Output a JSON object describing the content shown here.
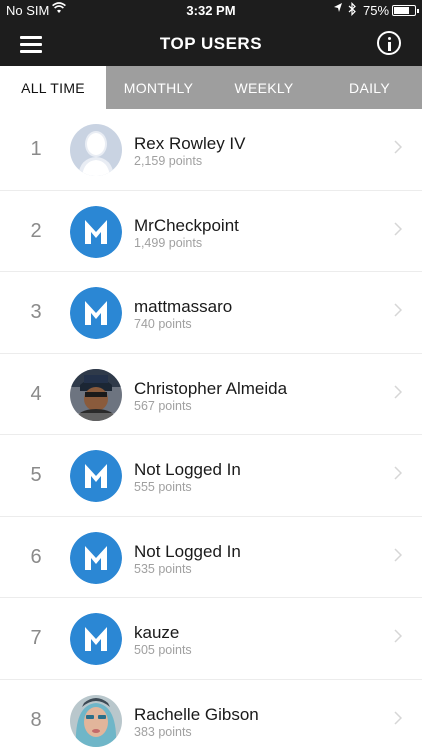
{
  "status_bar": {
    "carrier": "No SIM",
    "time": "3:32 PM",
    "battery": "75%",
    "battery_level": 0.75
  },
  "header": {
    "title": "TOP USERS",
    "menu_icon": "hamburger-menu-icon",
    "info_icon": "info-icon"
  },
  "tabs": [
    {
      "label": "ALL TIME",
      "active": true
    },
    {
      "label": "MONTHLY",
      "active": false
    },
    {
      "label": "WEEKLY",
      "active": false
    },
    {
      "label": "DAILY",
      "active": false
    }
  ],
  "users": [
    {
      "rank": "1",
      "name": "Rex Rowley IV",
      "points": "2,159 points",
      "avatar": "placeholder-silhouette"
    },
    {
      "rank": "2",
      "name": "MrCheckpoint",
      "points": "1,499 points",
      "avatar": "m-logo"
    },
    {
      "rank": "3",
      "name": "mattmassaro",
      "points": "740 points",
      "avatar": "m-logo"
    },
    {
      "rank": "4",
      "name": "Christopher Almeida",
      "points": "567 points",
      "avatar": "photo"
    },
    {
      "rank": "5",
      "name": "Not Logged In",
      "points": "555 points",
      "avatar": "m-logo"
    },
    {
      "rank": "6",
      "name": "Not Logged In",
      "points": "535 points",
      "avatar": "m-logo"
    },
    {
      "rank": "7",
      "name": "kauze",
      "points": "505 points",
      "avatar": "m-logo"
    },
    {
      "rank": "8",
      "name": "Rachelle Gibson",
      "points": "383 points",
      "avatar": "photo"
    }
  ],
  "colors": {
    "header_bg": "#1d1d1d",
    "tab_bg": "#9e9e9e",
    "m_logo_blue": "#2b87d4"
  }
}
